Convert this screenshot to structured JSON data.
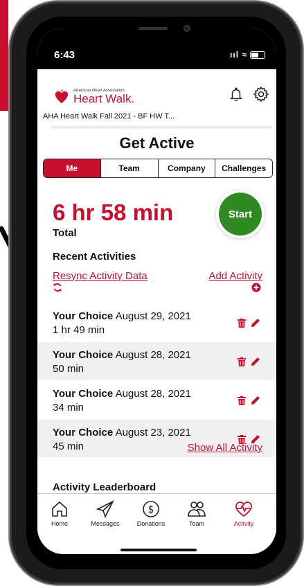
{
  "status": {
    "time": "6:43",
    "signal": "ııl"
  },
  "brand": {
    "line1": "American Heart Association.",
    "line2": "Heart Walk."
  },
  "event_name": "AHA Heart Walk Fall 2021 - BF HW T...",
  "page_title": "Get Active",
  "tabs": [
    {
      "label": "Me",
      "active": true
    },
    {
      "label": "Team",
      "active": false
    },
    {
      "label": "Company",
      "active": false
    },
    {
      "label": "Challenges",
      "active": false
    }
  ],
  "total": {
    "time": "6 hr 58 min",
    "label": "Total"
  },
  "start_label": "Start",
  "recent_title": "Recent Activities",
  "resync_label": "Resync Activity Data",
  "add_activity_label": "Add Activity",
  "activities": [
    {
      "type": "Your Choice",
      "date": "August 29, 2021",
      "duration": "1 hr 49 min"
    },
    {
      "type": "Your Choice",
      "date": "August 28, 2021",
      "duration": "50 min"
    },
    {
      "type": "Your Choice",
      "date": "August 28, 2021",
      "duration": "34 min"
    },
    {
      "type": "Your Choice",
      "date": "August 23, 2021",
      "duration": "45 min"
    }
  ],
  "show_all_label": "Show All Activity",
  "leaderboard_title": "Activity Leaderboard",
  "nav": [
    {
      "label": "Home",
      "icon": "home-icon"
    },
    {
      "label": "Messages",
      "icon": "paper-plane-icon"
    },
    {
      "label": "Donations",
      "icon": "dollar-icon"
    },
    {
      "label": "Team",
      "icon": "team-icon"
    },
    {
      "label": "Activity",
      "icon": "heartbeat-icon",
      "active": true
    }
  ],
  "colors": {
    "brand_red": "#c8102e",
    "start_green": "#2e8b22"
  }
}
